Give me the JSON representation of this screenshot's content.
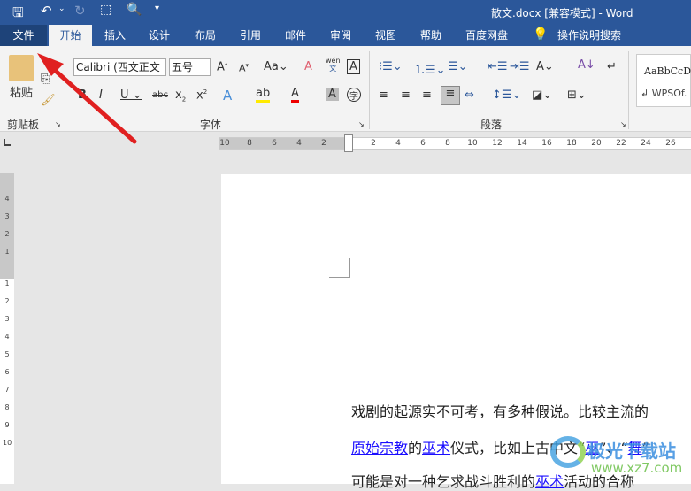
{
  "window": {
    "title": "散文.docx [兼容模式]  -  Word"
  },
  "quick_access": {
    "icons": [
      "save-icon",
      "undo-icon",
      "redo-icon",
      "touch-mode-icon",
      "print-preview-icon",
      "customize-icon"
    ]
  },
  "tabs": [
    {
      "label": "文件"
    },
    {
      "label": "开始"
    },
    {
      "label": "插入"
    },
    {
      "label": "设计"
    },
    {
      "label": "布局"
    },
    {
      "label": "引用"
    },
    {
      "label": "邮件"
    },
    {
      "label": "审阅"
    },
    {
      "label": "视图"
    },
    {
      "label": "帮助"
    },
    {
      "label": "百度网盘"
    }
  ],
  "tell_me": "操作说明搜索",
  "ribbon": {
    "clipboard": {
      "paste": "粘贴",
      "label": "剪贴板"
    },
    "font": {
      "name": "Calibri (西文正文",
      "size": "五号",
      "label": "字体",
      "wen": "wén",
      "wen2": "文"
    },
    "paragraph": {
      "label": "段落"
    },
    "styles": {
      "preview": "AaBbCcD",
      "name": "↲ WPSOf."
    }
  },
  "ruler": {
    "left": [
      "10",
      "8",
      "6",
      "4",
      "2"
    ],
    "right": [
      "2",
      "4",
      "6",
      "8",
      "10",
      "12",
      "14",
      "16",
      "18",
      "20",
      "22",
      "24",
      "26"
    ],
    "vertical": [
      "4",
      "3",
      "2",
      "1",
      "1",
      "2",
      "3",
      "4",
      "5",
      "6",
      "7",
      "8",
      "9",
      "10"
    ]
  },
  "document": {
    "line1": "戏剧的起源实不可考，有多种假说。比较主流的",
    "line2": {
      "link1": "原始宗教",
      "t1": "的",
      "link2": "巫术",
      "t2": "仪式，比如上古中文“",
      "link3": "巫",
      "t3": "”、“",
      "link4": "舞",
      "t4": "”"
    },
    "line3": {
      "t1": "可能是对一种乞求战斗胜利的",
      "link1": "巫术",
      "t2": "活动的合称"
    }
  },
  "watermark": {
    "text": "极光下载站",
    "url": "www.xz7.com"
  },
  "colors": {
    "accent": "#2b579a",
    "file_tab": "#1e4379",
    "link": "#1a0dff",
    "arrow": "#e02020"
  }
}
